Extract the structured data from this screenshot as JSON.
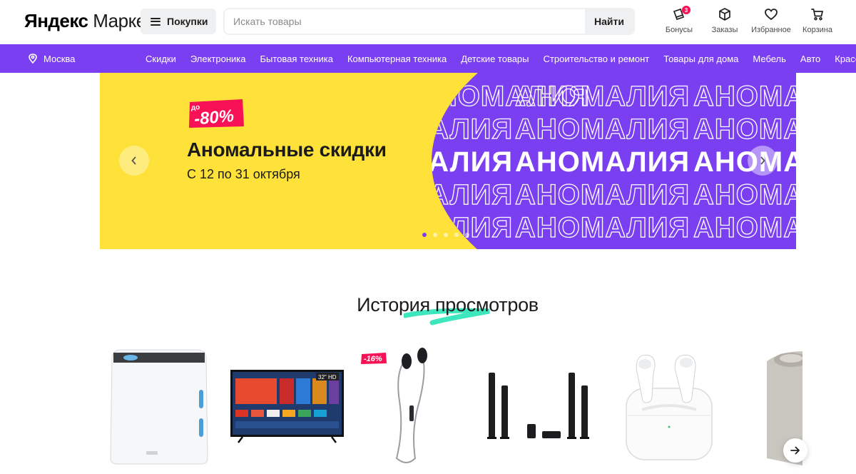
{
  "header": {
    "logo_bold": "Яндекс",
    "logo_light": "Маркет",
    "catalog_label": "Покупки",
    "search_placeholder": "Искать товары",
    "search_button": "Найти",
    "actions": [
      {
        "label": "Бонусы",
        "icon": "bonus-icon",
        "badge": "3"
      },
      {
        "label": "Заказы",
        "icon": "box-icon"
      },
      {
        "label": "Избранное",
        "icon": "heart-icon"
      },
      {
        "label": "Корзина",
        "icon": "cart-icon"
      }
    ]
  },
  "nav": {
    "city": "Москва",
    "items": [
      "Скидки",
      "Электроника",
      "Бытовая техника",
      "Компьютерная техника",
      "Детские товары",
      "Строительство и ремонт",
      "Товары для дома",
      "Мебель",
      "Авто",
      "Красота"
    ]
  },
  "banner": {
    "sticker_prefix": "до",
    "sticker_value": "-80%",
    "title": "Аномальные скидки",
    "subtitle": "С 12 по 31 октября",
    "pattern_word": "АНОМАЛИЯ",
    "slides": 5,
    "active_slide": 0
  },
  "history": {
    "title": "История просмотров",
    "products": [
      {
        "name": "air-purifier"
      },
      {
        "name": "tv",
        "screen_badge": "32\" HD"
      },
      {
        "name": "headphones",
        "discount": "-16%"
      },
      {
        "name": "speaker-system"
      },
      {
        "name": "earbuds"
      },
      {
        "name": "smart-speaker"
      }
    ]
  },
  "colors": {
    "accent_purple": "#7b3ff2",
    "banner_yellow": "#fee23a",
    "discount_red": "#f91155",
    "swoosh_green": "#3ee6bd"
  }
}
